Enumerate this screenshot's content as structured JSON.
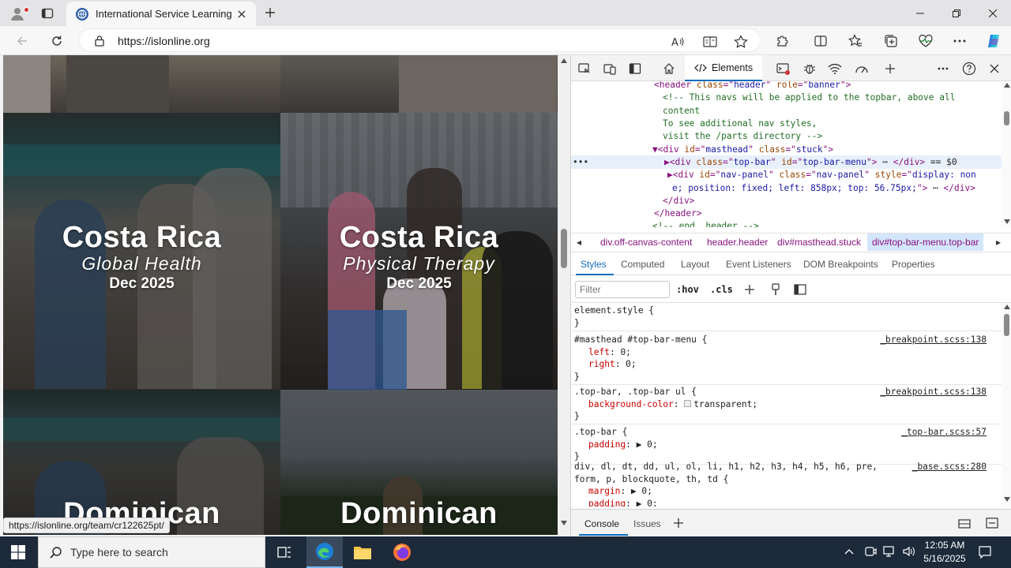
{
  "browser": {
    "tab_title": "International Service Learning",
    "url": "https://islonline.org",
    "status_url": "https://islonline.org/team/cr122625pt/"
  },
  "page": {
    "tiles": [
      {
        "country": "Costa Rica",
        "program": "Global Health",
        "date": "Dec 2025"
      },
      {
        "country": "Costa Rica",
        "program": "Physical Therapy",
        "date": "Dec 2025"
      },
      {
        "country": "Dominican",
        "program": "",
        "date": ""
      },
      {
        "country": "Dominican",
        "program": "",
        "date": ""
      }
    ]
  },
  "devtools": {
    "elements_tab": "Elements",
    "dom_lines": [
      {
        "parts": [
          [
            "tag",
            "<header "
          ],
          [
            "an",
            "class"
          ],
          [
            "tag",
            "=\""
          ],
          [
            "av",
            "header"
          ],
          [
            "tag",
            "\" "
          ],
          [
            "an",
            "role"
          ],
          [
            "tag",
            "=\""
          ],
          [
            "av",
            "banner"
          ],
          [
            "tag",
            "\">"
          ]
        ]
      },
      {
        "parts": [
          [
            "cm",
            "<!-- This navs will be applied to the topbar, above all"
          ]
        ]
      },
      {
        "parts": [
          [
            "cm",
            "content"
          ]
        ]
      },
      {
        "parts": [
          [
            "cm",
            "                         To see additional nav styles,"
          ]
        ]
      },
      {
        "parts": [
          [
            "cm",
            "visit the /parts directory -->"
          ]
        ]
      },
      {
        "parts": [
          [
            "tag",
            "▼<div "
          ],
          [
            "an",
            "id"
          ],
          [
            "tag",
            "=\""
          ],
          [
            "av",
            "masthead"
          ],
          [
            "tag",
            "\" "
          ],
          [
            "an",
            "class"
          ],
          [
            "tag",
            "=\""
          ],
          [
            "av",
            "stuck"
          ],
          [
            "tag",
            "\">"
          ]
        ]
      },
      {
        "parts": [
          [
            "tag",
            "▶<div "
          ],
          [
            "an",
            "class"
          ],
          [
            "tag",
            "=\""
          ],
          [
            "av",
            "top-bar"
          ],
          [
            "tag",
            "\" "
          ],
          [
            "an",
            "id"
          ],
          [
            "tag",
            "=\""
          ],
          [
            "av",
            "top-bar-menu"
          ],
          [
            "tag",
            "\">"
          ],
          [
            "tx",
            " ⋯ "
          ],
          [
            "tag",
            "</div>"
          ],
          [
            "tx",
            " == $0"
          ]
        ]
      },
      {
        "parts": [
          [
            "tag",
            "▶<div "
          ],
          [
            "an",
            "id"
          ],
          [
            "tag",
            "=\""
          ],
          [
            "av",
            "nav-panel"
          ],
          [
            "tag",
            "\" "
          ],
          [
            "an",
            "class"
          ],
          [
            "tag",
            "=\""
          ],
          [
            "av",
            "nav-panel"
          ],
          [
            "tag",
            "\" "
          ],
          [
            "an",
            "style"
          ],
          [
            "tag",
            "=\""
          ],
          [
            "av",
            "display: non"
          ]
        ]
      },
      {
        "parts": [
          [
            "av",
            "e; position: fixed; left: 858px; top: 56.75px;"
          ],
          [
            "tag",
            "\">"
          ],
          [
            "tx",
            " ⋯ "
          ],
          [
            "tag",
            "</div>"
          ]
        ]
      },
      {
        "parts": [
          [
            "tag",
            "</div>"
          ]
        ]
      },
      {
        "parts": [
          [
            "tag",
            "</header>"
          ]
        ]
      },
      {
        "parts": [
          [
            "cm",
            "<!-- end .header -->"
          ]
        ]
      }
    ],
    "breadcrumbs": [
      "div.off-canvas-content",
      "header.header",
      "div#masthead.stuck",
      "div#top-bar-menu.top-bar"
    ],
    "subtabs": [
      "Styles",
      "Computed",
      "Layout",
      "Event Listeners",
      "DOM Breakpoints",
      "Properties"
    ],
    "filter_placeholder": "Filter",
    "hov": ":hov",
    "cls": ".cls",
    "rules": [
      {
        "selector": "element.style {",
        "source": "",
        "props": []
      },
      {
        "selector": "#masthead #top-bar-menu {",
        "source": "_breakpoint.scss:138",
        "props": [
          [
            "left",
            "0;"
          ],
          [
            "right",
            "0;"
          ]
        ]
      },
      {
        "selector": ".top-bar, .top-bar ul {",
        "source": "_breakpoint.scss:138",
        "props": [
          [
            "background-color",
            "transparent;"
          ]
        ]
      },
      {
        "selector": ".top-bar {",
        "source": "_top-bar.scss:57",
        "props": [
          [
            "padding",
            "▶ 0;"
          ]
        ]
      },
      {
        "selector": "div, dl, dt, dd, ul, ol, li, h1, h2, h3, h4, h5, h6, pre,",
        "source": "_base.scss:280",
        "props": []
      }
    ],
    "rule_last_line2": "form, p, blockquote, th, td {",
    "rule_last_props": [
      [
        "margin",
        "▶ 0;"
      ],
      [
        "padding",
        "▶ 0;"
      ]
    ],
    "drawer_tabs": [
      "Console",
      "Issues"
    ]
  },
  "taskbar": {
    "search_placeholder": "Type here to search",
    "time": "12:05 AM",
    "date": "5/16/2025"
  },
  "colors": {
    "accent": "#0f6cbd",
    "taskbar": "#1c2a3a"
  }
}
